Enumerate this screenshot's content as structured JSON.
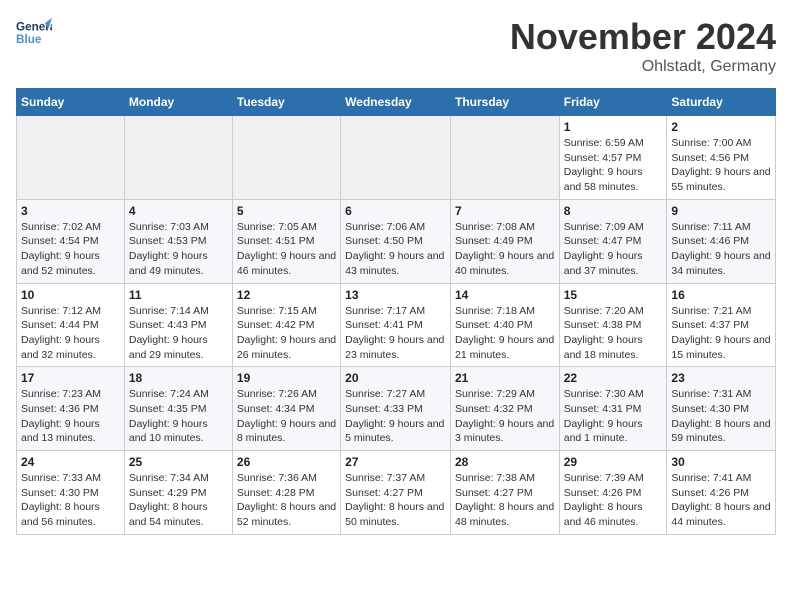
{
  "header": {
    "logo_general": "General",
    "logo_blue": "Blue",
    "month_title": "November 2024",
    "location": "Ohlstadt, Germany"
  },
  "weekdays": [
    "Sunday",
    "Monday",
    "Tuesday",
    "Wednesday",
    "Thursday",
    "Friday",
    "Saturday"
  ],
  "weeks": [
    [
      {
        "day": "",
        "info": ""
      },
      {
        "day": "",
        "info": ""
      },
      {
        "day": "",
        "info": ""
      },
      {
        "day": "",
        "info": ""
      },
      {
        "day": "",
        "info": ""
      },
      {
        "day": "1",
        "info": "Sunrise: 6:59 AM\nSunset: 4:57 PM\nDaylight: 9 hours and 58 minutes."
      },
      {
        "day": "2",
        "info": "Sunrise: 7:00 AM\nSunset: 4:56 PM\nDaylight: 9 hours and 55 minutes."
      }
    ],
    [
      {
        "day": "3",
        "info": "Sunrise: 7:02 AM\nSunset: 4:54 PM\nDaylight: 9 hours and 52 minutes."
      },
      {
        "day": "4",
        "info": "Sunrise: 7:03 AM\nSunset: 4:53 PM\nDaylight: 9 hours and 49 minutes."
      },
      {
        "day": "5",
        "info": "Sunrise: 7:05 AM\nSunset: 4:51 PM\nDaylight: 9 hours and 46 minutes."
      },
      {
        "day": "6",
        "info": "Sunrise: 7:06 AM\nSunset: 4:50 PM\nDaylight: 9 hours and 43 minutes."
      },
      {
        "day": "7",
        "info": "Sunrise: 7:08 AM\nSunset: 4:49 PM\nDaylight: 9 hours and 40 minutes."
      },
      {
        "day": "8",
        "info": "Sunrise: 7:09 AM\nSunset: 4:47 PM\nDaylight: 9 hours and 37 minutes."
      },
      {
        "day": "9",
        "info": "Sunrise: 7:11 AM\nSunset: 4:46 PM\nDaylight: 9 hours and 34 minutes."
      }
    ],
    [
      {
        "day": "10",
        "info": "Sunrise: 7:12 AM\nSunset: 4:44 PM\nDaylight: 9 hours and 32 minutes."
      },
      {
        "day": "11",
        "info": "Sunrise: 7:14 AM\nSunset: 4:43 PM\nDaylight: 9 hours and 29 minutes."
      },
      {
        "day": "12",
        "info": "Sunrise: 7:15 AM\nSunset: 4:42 PM\nDaylight: 9 hours and 26 minutes."
      },
      {
        "day": "13",
        "info": "Sunrise: 7:17 AM\nSunset: 4:41 PM\nDaylight: 9 hours and 23 minutes."
      },
      {
        "day": "14",
        "info": "Sunrise: 7:18 AM\nSunset: 4:40 PM\nDaylight: 9 hours and 21 minutes."
      },
      {
        "day": "15",
        "info": "Sunrise: 7:20 AM\nSunset: 4:38 PM\nDaylight: 9 hours and 18 minutes."
      },
      {
        "day": "16",
        "info": "Sunrise: 7:21 AM\nSunset: 4:37 PM\nDaylight: 9 hours and 15 minutes."
      }
    ],
    [
      {
        "day": "17",
        "info": "Sunrise: 7:23 AM\nSunset: 4:36 PM\nDaylight: 9 hours and 13 minutes."
      },
      {
        "day": "18",
        "info": "Sunrise: 7:24 AM\nSunset: 4:35 PM\nDaylight: 9 hours and 10 minutes."
      },
      {
        "day": "19",
        "info": "Sunrise: 7:26 AM\nSunset: 4:34 PM\nDaylight: 9 hours and 8 minutes."
      },
      {
        "day": "20",
        "info": "Sunrise: 7:27 AM\nSunset: 4:33 PM\nDaylight: 9 hours and 5 minutes."
      },
      {
        "day": "21",
        "info": "Sunrise: 7:29 AM\nSunset: 4:32 PM\nDaylight: 9 hours and 3 minutes."
      },
      {
        "day": "22",
        "info": "Sunrise: 7:30 AM\nSunset: 4:31 PM\nDaylight: 9 hours and 1 minute."
      },
      {
        "day": "23",
        "info": "Sunrise: 7:31 AM\nSunset: 4:30 PM\nDaylight: 8 hours and 59 minutes."
      }
    ],
    [
      {
        "day": "24",
        "info": "Sunrise: 7:33 AM\nSunset: 4:30 PM\nDaylight: 8 hours and 56 minutes."
      },
      {
        "day": "25",
        "info": "Sunrise: 7:34 AM\nSunset: 4:29 PM\nDaylight: 8 hours and 54 minutes."
      },
      {
        "day": "26",
        "info": "Sunrise: 7:36 AM\nSunset: 4:28 PM\nDaylight: 8 hours and 52 minutes."
      },
      {
        "day": "27",
        "info": "Sunrise: 7:37 AM\nSunset: 4:27 PM\nDaylight: 8 hours and 50 minutes."
      },
      {
        "day": "28",
        "info": "Sunrise: 7:38 AM\nSunset: 4:27 PM\nDaylight: 8 hours and 48 minutes."
      },
      {
        "day": "29",
        "info": "Sunrise: 7:39 AM\nSunset: 4:26 PM\nDaylight: 8 hours and 46 minutes."
      },
      {
        "day": "30",
        "info": "Sunrise: 7:41 AM\nSunset: 4:26 PM\nDaylight: 8 hours and 44 minutes."
      }
    ]
  ]
}
